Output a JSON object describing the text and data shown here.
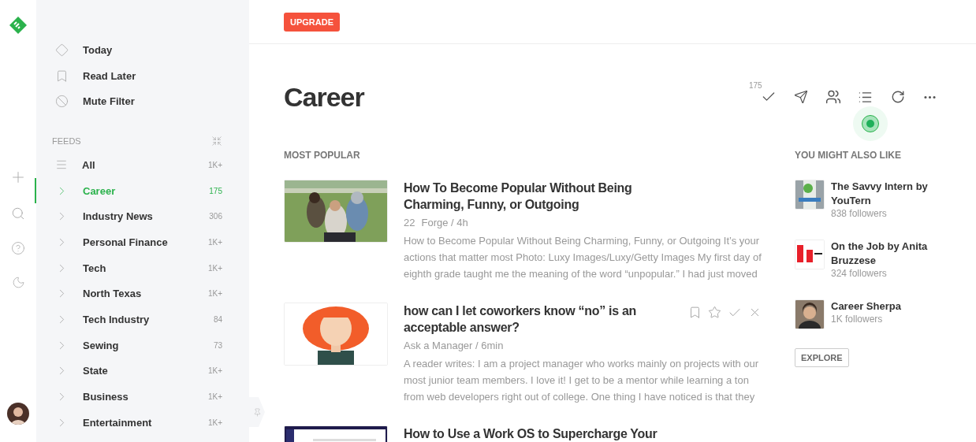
{
  "upgrade_button": "UPGRADE",
  "nav": [
    {
      "kind": "today",
      "label": "Today"
    },
    {
      "kind": "later",
      "label": "Read Later"
    },
    {
      "kind": "mute",
      "label": "Mute Filter"
    }
  ],
  "feeds": {
    "heading": "FEEDS",
    "items": [
      {
        "kind": "all",
        "label": "All",
        "count": "1K+",
        "selected": false
      },
      {
        "kind": "folder",
        "label": "Career",
        "count": "175",
        "selected": true
      },
      {
        "kind": "folder",
        "label": "Industry News",
        "count": "306",
        "selected": false
      },
      {
        "kind": "folder",
        "label": "Personal Finance",
        "count": "1K+",
        "selected": false
      },
      {
        "kind": "folder",
        "label": "Tech",
        "count": "1K+",
        "selected": false
      },
      {
        "kind": "folder",
        "label": "North Texas",
        "count": "1K+",
        "selected": false
      },
      {
        "kind": "folder",
        "label": "Tech Industry",
        "count": "84",
        "selected": false
      },
      {
        "kind": "folder",
        "label": "Sewing",
        "count": "73",
        "selected": false
      },
      {
        "kind": "folder",
        "label": "State",
        "count": "1K+",
        "selected": false
      },
      {
        "kind": "folder",
        "label": "Business",
        "count": "1K+",
        "selected": false
      },
      {
        "kind": "folder",
        "label": "Entertainment",
        "count": "1K+",
        "selected": false
      }
    ]
  },
  "page": {
    "title": "Career",
    "unread_count": "175"
  },
  "section_title": "MOST POPULAR",
  "articles": [
    {
      "title": "How To Become Popular Without Being Charming, Funny, or Outgoing",
      "engagement": "22",
      "meta": "Forge / 4h",
      "summary": "How to Become Popular Without Being Charming, Funny, or Outgoing It’s your actions that matter most Photo: Luxy Images/Luxy/Getty Images My first day of eighth grade taught me the meaning of the word “unpopular.” I had just moved",
      "actions_shown": false
    },
    {
      "kind": "cartoon",
      "title": "how can I let coworkers know “no” is an acceptable answer?",
      "meta": "Ask a Manager / 6min",
      "summary": "A reader writes: I am a project manager who works mainly on projects with our most junior team members. I love it! I get to be a mentor while learning a ton from web developers right out of college. One thing I have noticed is that they",
      "actions_shown": true
    },
    {
      "kind": "screenshot",
      "title": "How to Use a Work OS to Supercharge Your",
      "actions_shown": false
    }
  ],
  "suggestions": {
    "heading": "YOU MIGHT ALSO LIKE",
    "items": [
      {
        "kind": "logo",
        "name": "The Savvy Intern by YouTern",
        "followers": "838 followers"
      },
      {
        "kind": "text",
        "name": "On the Job by Anita Bruzzese",
        "followers": "324 followers"
      },
      {
        "kind": "portrait",
        "name": "Career Sherpa",
        "followers": "1K followers"
      }
    ],
    "explore": "EXPLORE"
  }
}
